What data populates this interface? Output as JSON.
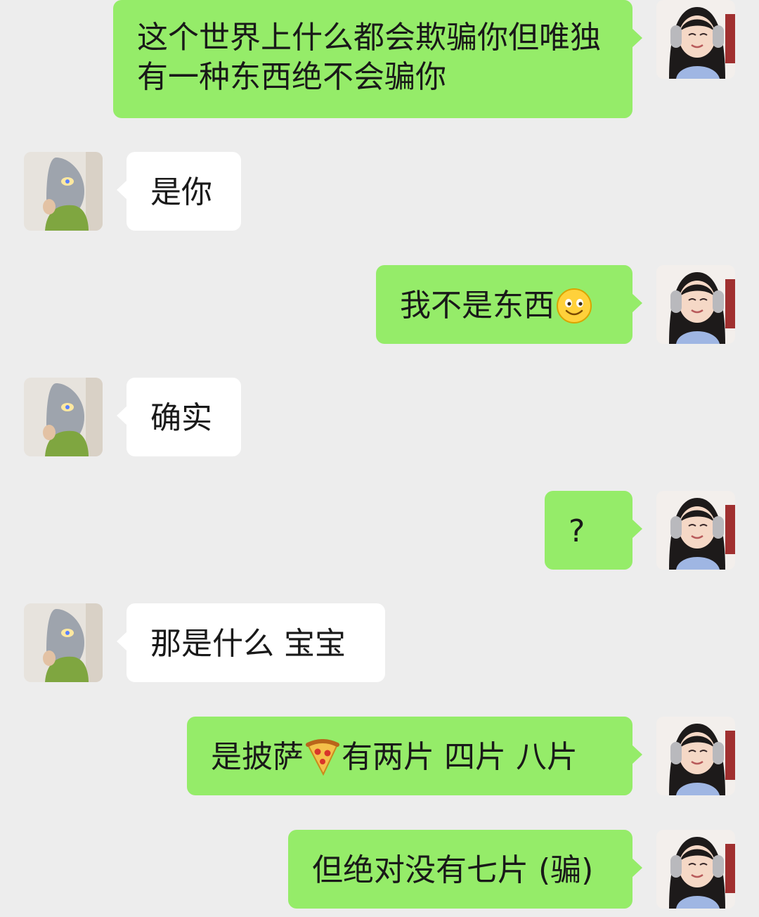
{
  "colors": {
    "background": "#ededed",
    "my_bubble": "#95ec69",
    "their_bubble": "#ffffff",
    "text": "#191919"
  },
  "messages": [
    {
      "sender": "me",
      "text": "这个世界上什么都会欺骗你但唯独有一种东西绝不会骗你"
    },
    {
      "sender": "them",
      "text": "是你"
    },
    {
      "sender": "me",
      "text": "我不是东西",
      "emoji": "smile-emoji"
    },
    {
      "sender": "them",
      "text": "确实"
    },
    {
      "sender": "me",
      "text": "?"
    },
    {
      "sender": "them",
      "text": "那是什么 宝宝"
    },
    {
      "sender": "me",
      "text_before": "是披萨",
      "emoji": "pizza-emoji",
      "text_after": "有两片 四片 八片"
    },
    {
      "sender": "me",
      "text": "但绝对没有七片 (骗)"
    }
  ],
  "avatars": {
    "me": "girl-with-headphones-avatar",
    "them": "ultraman-mask-avatar"
  }
}
